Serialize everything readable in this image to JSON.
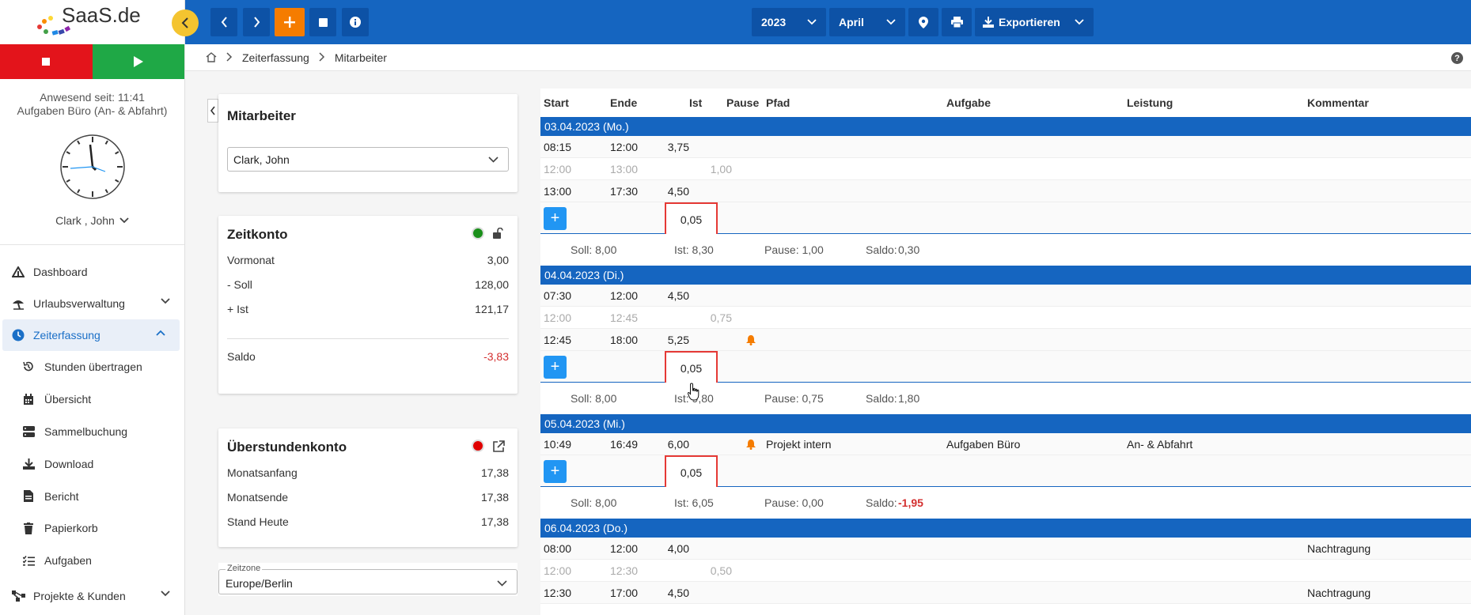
{
  "brand": {
    "logo_text": "SaaS.de"
  },
  "presence": {
    "line1": "Anwesend seit: 11:41",
    "line2": "Aufgaben Büro (An- & Abfahrt)"
  },
  "user": {
    "name": "Clark , John"
  },
  "nav": {
    "dashboard": "Dashboard",
    "urlaub": "Urlaubsverwaltung",
    "zeiterfassung": "Zeiterfassung",
    "stunden": "Stunden übertragen",
    "uebersicht": "Übersicht",
    "sammel": "Sammelbuchung",
    "download": "Download",
    "bericht": "Bericht",
    "papierkorb": "Papierkorb",
    "aufgaben": "Aufgaben",
    "projekte": "Projekte & Kunden"
  },
  "toolbar": {
    "year": "2023",
    "month": "April",
    "export_label": "Exportieren"
  },
  "breadcrumb": {
    "level1": "Zeiterfassung",
    "level2": "Mitarbeiter"
  },
  "mitarbeiter": {
    "title": "Mitarbeiter",
    "selected": "Clark, John"
  },
  "zeitkonto": {
    "title": "Zeitkonto",
    "status_color": "#1a8f1a",
    "rows": [
      {
        "label": "Vormonat",
        "value": "3,00"
      },
      {
        "label": "- Soll",
        "value": "128,00"
      },
      {
        "label": "+ Ist",
        "value": "121,17"
      }
    ],
    "saldo_label": "Saldo",
    "saldo_value": "-3,83"
  },
  "ueberstunden": {
    "title": "Überstundenkonto",
    "status_color": "#e00000",
    "rows": [
      {
        "label": "Monatsanfang",
        "value": "17,38"
      },
      {
        "label": "Monatsende",
        "value": "17,38"
      },
      {
        "label": "Stand Heute",
        "value": "17,38"
      }
    ]
  },
  "zeitzone": {
    "label": "Zeitzone",
    "value": "Europe/Berlin"
  },
  "table": {
    "headers": {
      "start": "Start",
      "ende": "Ende",
      "ist": "Ist",
      "pause": "Pause",
      "pfad": "Pfad",
      "aufgabe": "Aufgabe",
      "leistung": "Leistung",
      "kommentar": "Kommentar"
    },
    "days": [
      {
        "date": "03.04.2023 (Mo.)",
        "entries": [
          {
            "start": "08:15",
            "ende": "12:00",
            "ist": "3,75",
            "pause": "",
            "pfad": "",
            "aufgabe": "",
            "leistung": "",
            "kommentar": "",
            "type": "work"
          },
          {
            "start": "12:00",
            "ende": "13:00",
            "ist": "",
            "pause": "1,00",
            "pfad": "",
            "aufgabe": "",
            "leistung": "",
            "kommentar": "",
            "type": "pause"
          },
          {
            "start": "13:00",
            "ende": "17:30",
            "ist": "4,50",
            "pause": "",
            "pfad": "",
            "aufgabe": "",
            "leistung": "",
            "kommentar": "",
            "type": "work"
          }
        ],
        "add_value": "0,05",
        "summary": {
          "soll": "Soll: 8,00",
          "ist": "Ist: 8,30",
          "pause": "Pause: 1,00",
          "saldo_label": "Saldo:",
          "saldo_value": "0,30",
          "saldo_negative": false
        }
      },
      {
        "date": "04.04.2023 (Di.)",
        "entries": [
          {
            "start": "07:30",
            "ende": "12:00",
            "ist": "4,50",
            "pause": "",
            "pfad": "",
            "aufgabe": "",
            "leistung": "",
            "kommentar": "",
            "type": "work"
          },
          {
            "start": "12:00",
            "ende": "12:45",
            "ist": "",
            "pause": "0,75",
            "pfad": "",
            "aufgabe": "",
            "leistung": "",
            "kommentar": "",
            "type": "pause"
          },
          {
            "start": "12:45",
            "ende": "18:00",
            "ist": "5,25",
            "pause": "",
            "pfad": "",
            "aufgabe": "",
            "leistung": "",
            "kommentar": "",
            "type": "work",
            "bell": true
          }
        ],
        "add_value": "0,05",
        "summary": {
          "soll": "Soll: 8,00",
          "ist": "Ist: 9,80",
          "pause": "Pause: 0,75",
          "saldo_label": "Saldo:",
          "saldo_value": "1,80",
          "saldo_negative": false
        }
      },
      {
        "date": "05.04.2023 (Mi.)",
        "entries": [
          {
            "start": "10:49",
            "ende": "16:49",
            "ist": "6,00",
            "pause": "",
            "pfad": "Projekt intern",
            "aufgabe": "Aufgaben Büro",
            "leistung": "An- & Abfahrt",
            "kommentar": "",
            "type": "work",
            "bell": true
          }
        ],
        "add_value": "0,05",
        "summary": {
          "soll": "Soll: 8,00",
          "ist": "Ist: 6,05",
          "pause": "Pause: 0,00",
          "saldo_label": "Saldo:",
          "saldo_value": "-1,95",
          "saldo_negative": true
        }
      },
      {
        "date": "06.04.2023 (Do.)",
        "entries": [
          {
            "start": "08:00",
            "ende": "12:00",
            "ist": "4,00",
            "pause": "",
            "pfad": "",
            "aufgabe": "",
            "leistung": "",
            "kommentar": "Nachtragung",
            "type": "work"
          },
          {
            "start": "12:00",
            "ende": "12:30",
            "ist": "",
            "pause": "0,50",
            "pfad": "",
            "aufgabe": "",
            "leistung": "",
            "kommentar": "",
            "type": "pause"
          },
          {
            "start": "12:30",
            "ende": "17:00",
            "ist": "4,50",
            "pause": "",
            "pfad": "",
            "aufgabe": "",
            "leistung": "",
            "kommentar": "Nachtragung",
            "type": "work"
          }
        ]
      }
    ]
  }
}
